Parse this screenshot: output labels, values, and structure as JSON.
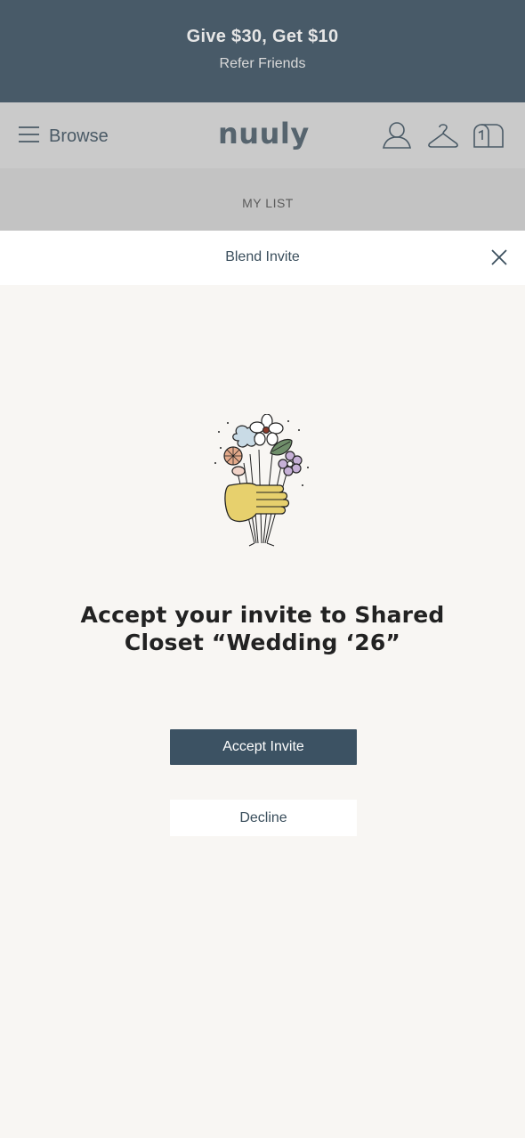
{
  "promo": {
    "title": "Give $30, Get $10",
    "link": "Refer Friends"
  },
  "header": {
    "browse_label": "Browse",
    "logo": "nuuly",
    "icons": [
      "menu-icon",
      "account-icon",
      "hanger-icon",
      "box-icon"
    ]
  },
  "subnav": {
    "label": "MY LIST"
  },
  "modal": {
    "title": "Blend Invite",
    "heading": "Accept your invite to Shared Closet “Wedding ‘26”",
    "accept_label": "Accept Invite",
    "decline_label": "Decline"
  },
  "colors": {
    "promo_bg": "#485a68",
    "header_bg": "#cacaca",
    "subnav_bg": "#c3c3c3",
    "accent": "#3c5263",
    "page_bg": "#f8f6f3"
  }
}
